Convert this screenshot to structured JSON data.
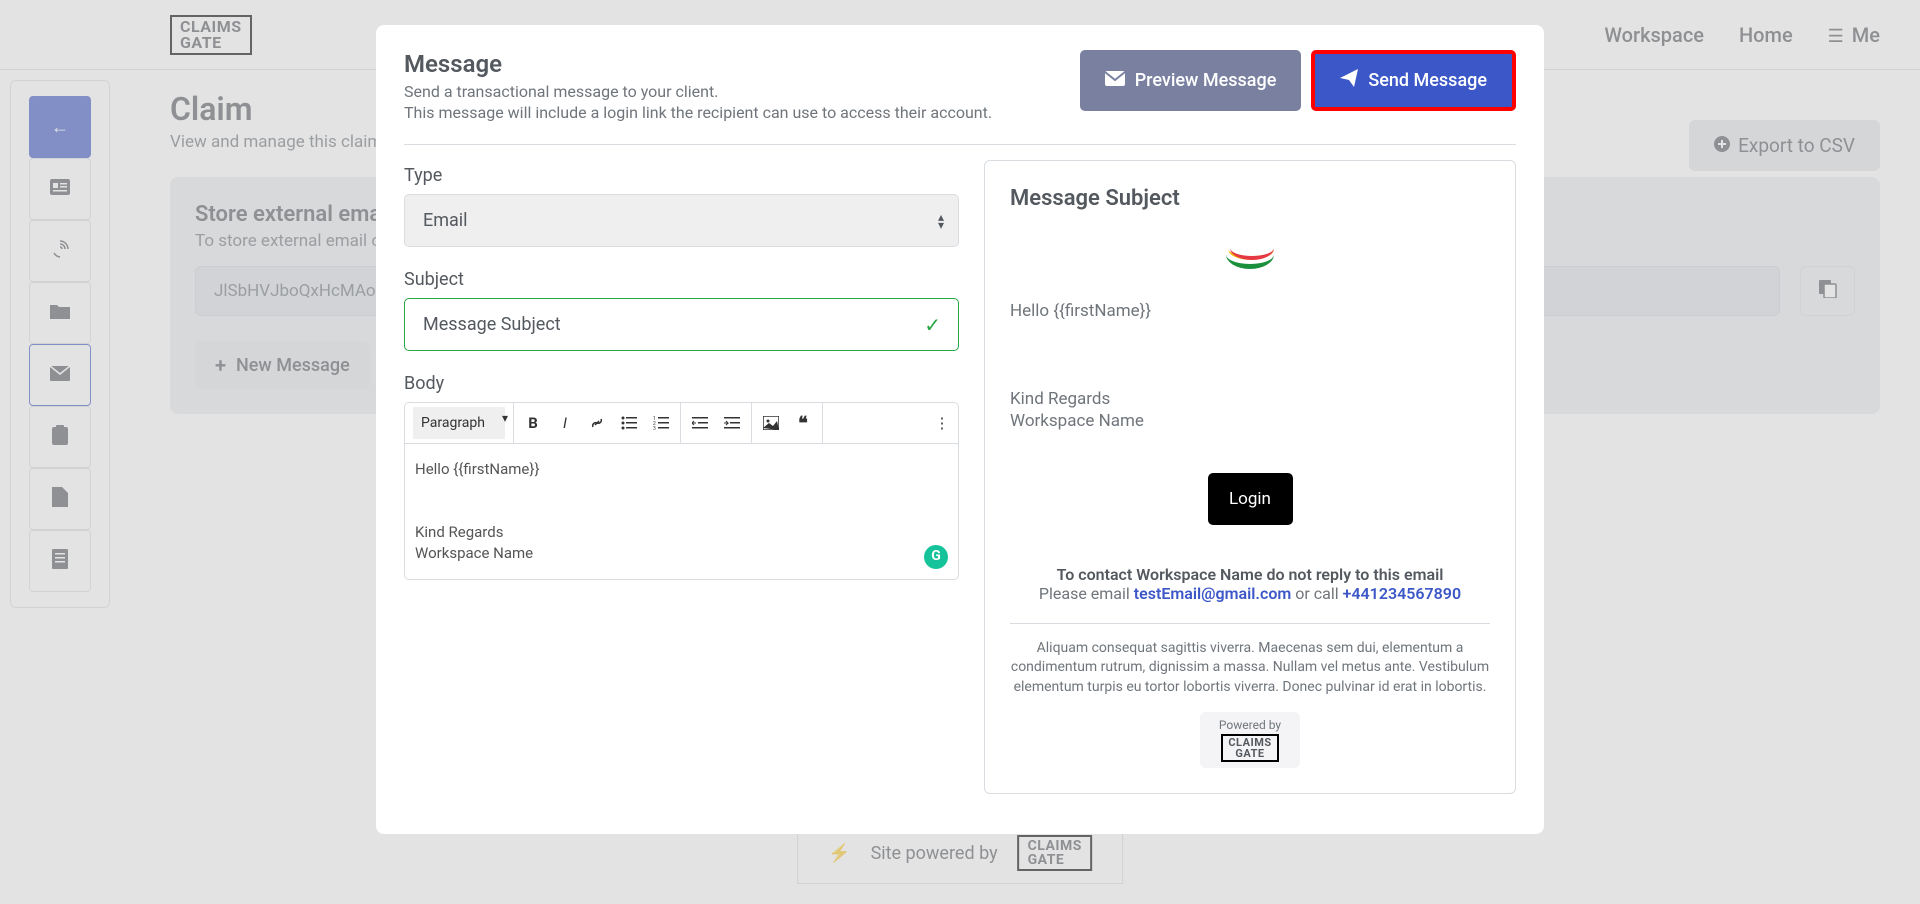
{
  "topnav": {
    "logo_line1": "CLAIMS",
    "logo_line2": "GATE",
    "links": {
      "workspace": "Workspace",
      "home": "Home",
      "me": "Me"
    }
  },
  "sidebar": {
    "items": [
      {
        "name": "back-icon",
        "glyph": "←"
      },
      {
        "name": "id-card-icon",
        "glyph": "🪪"
      },
      {
        "name": "fingerprint-icon",
        "glyph": "☍"
      },
      {
        "name": "folder-icon",
        "glyph": "📁"
      },
      {
        "name": "mail-icon",
        "glyph": "✉"
      },
      {
        "name": "clipboard-icon",
        "glyph": "📋"
      },
      {
        "name": "file-icon",
        "glyph": "📄"
      },
      {
        "name": "document-icon",
        "glyph": "🧾"
      }
    ]
  },
  "page": {
    "title": "Claim",
    "subtitle": "View and manage this claim.",
    "export_btn": "Export to CSV",
    "card_title": "Store external email",
    "card_sub": "To store external email on this claim...",
    "hash_value": "JlSbHVJboQxHcMAoJT",
    "new_message_btn": "New Message"
  },
  "footer": {
    "powered_by": "Site powered by",
    "logo_line1": "CLAIMS",
    "logo_line2": "GATE"
  },
  "modal": {
    "title": "Message",
    "subtitle1": "Send a transactional message to your client.",
    "subtitle2": "This message will include a login link the recipient can use to access their account.",
    "preview_btn": "Preview Message",
    "send_btn": "Send Message",
    "type_label": "Type",
    "type_value": "Email",
    "subject_label": "Subject",
    "subject_value": "Message Subject",
    "body_label": "Body",
    "toolbar_paragraph": "Paragraph",
    "body_line1": "Hello {{firstName}}",
    "body_line2": "Kind Regards",
    "body_line3": "Workspace Name"
  },
  "preview": {
    "subject_heading": "Message Subject",
    "greeting": "Hello {{firstName}}",
    "sign1": "Kind Regards",
    "sign2": "Workspace Name",
    "login_btn": "Login",
    "contact_bold": "To contact Workspace Name do not reply to this email",
    "please_email": "Please email ",
    "email_link": "testEmail@gmail.com",
    "or_call": " or call ",
    "phone_link": "+441234567890",
    "legal": "Aliquam consequat sagittis viverra. Maecenas sem dui, elementum a condimentum rutrum, dignissim a massa. Nullam vel metus ante. Vestibulum elementum turpis eu tortor lobortis viverra. Donec pulvinar id erat in lobortis.",
    "powered_by": "Powered by",
    "logo_line1": "CLAIMS",
    "logo_line2": "GATE"
  }
}
